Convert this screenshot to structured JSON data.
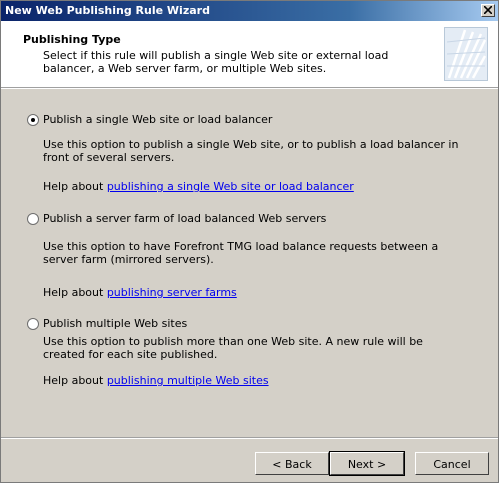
{
  "window": {
    "title": "New Web Publishing Rule Wizard"
  },
  "header": {
    "title": "Publishing Type",
    "description": "Select if this rule will publish a single Web site or external load balancer, a Web server farm, or multiple Web sites."
  },
  "options": [
    {
      "label": "Publish a single Web site or load balancer",
      "selected": true,
      "description": "Use this option to publish a single Web site, or to publish a load balancer in front of several servers.",
      "help_prefix": "Help about",
      "help_link": "publishing a single Web site or load balancer"
    },
    {
      "label": "Publish a server farm of load balanced Web servers",
      "selected": false,
      "description": "Use this option to have Forefront TMG load balance requests between a server farm (mirrored servers).",
      "help_prefix": "Help about",
      "help_link": "publishing server farms"
    },
    {
      "label": "Publish multiple Web sites",
      "selected": false,
      "description": "Use this option to publish more than one Web site. A new rule will be created for each site published.",
      "help_prefix": "Help about",
      "help_link": "publishing multiple Web sites"
    }
  ],
  "buttons": {
    "back": "< Back",
    "next": "Next >",
    "cancel": "Cancel"
  }
}
